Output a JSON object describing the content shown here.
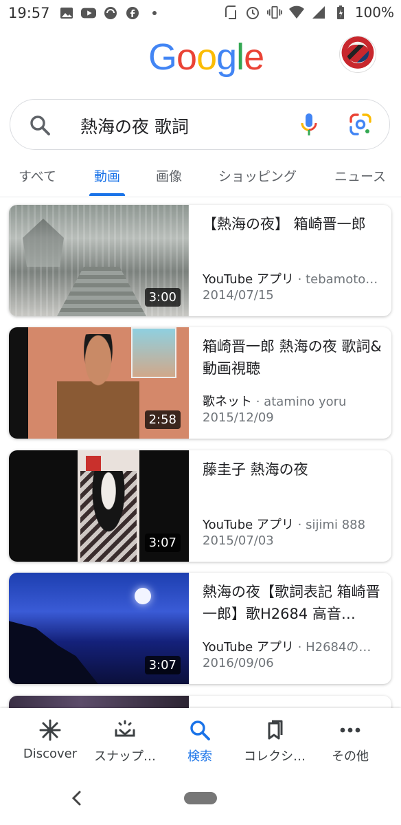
{
  "status_bar": {
    "time": "19:57",
    "battery": "100%"
  },
  "header": {
    "logo_letters": [
      {
        "char": "G",
        "color": "#4285F4"
      },
      {
        "char": "o",
        "color": "#EA4335"
      },
      {
        "char": "o",
        "color": "#FBBC05"
      },
      {
        "char": "g",
        "color": "#4285F4"
      },
      {
        "char": "l",
        "color": "#34A853"
      },
      {
        "char": "e",
        "color": "#EA4335"
      }
    ]
  },
  "search": {
    "query": "熱海の夜 歌詞"
  },
  "tabs": [
    {
      "label": "すべて"
    },
    {
      "label": "動画"
    },
    {
      "label": "画像"
    },
    {
      "label": "ショッピング"
    },
    {
      "label": "ニュース"
    }
  ],
  "active_tab": "動画",
  "results": [
    {
      "title": "【熱海の夜】 箱崎晋一郎",
      "source": "YouTube アプリ",
      "channel": " · tebamoto…",
      "date": "2014/07/15",
      "duration": "3:00"
    },
    {
      "title": "箱崎晋一郎 熱海の夜 歌詞&動画視聴",
      "source": "歌ネット",
      "channel": " · atamino yoru",
      "date": "2015/12/09",
      "duration": "2:58"
    },
    {
      "title": "藤圭子 熱海の夜",
      "source": "YouTube アプリ",
      "channel": " · sijimi 888",
      "date": "2015/07/03",
      "duration": "3:07"
    },
    {
      "title": "熱海の夜【歌詞表記 箱崎晋一郎】歌H2684 高音…",
      "source": "YouTube アプリ",
      "channel": " · H2684の…",
      "date": "2016/09/06",
      "duration": "3:07"
    }
  ],
  "bottom_nav": [
    {
      "label": "Discover",
      "icon": "asterisk-icon"
    },
    {
      "label": "スナップ…",
      "icon": "snapshot-icon"
    },
    {
      "label": "検索",
      "icon": "search-icon"
    },
    {
      "label": "コレクシ…",
      "icon": "bookmark-icon"
    },
    {
      "label": "その他",
      "icon": "more-icon"
    }
  ],
  "colors": {
    "accent": "#1a73e8",
    "text": "#202124",
    "secondary": "#70757a"
  }
}
